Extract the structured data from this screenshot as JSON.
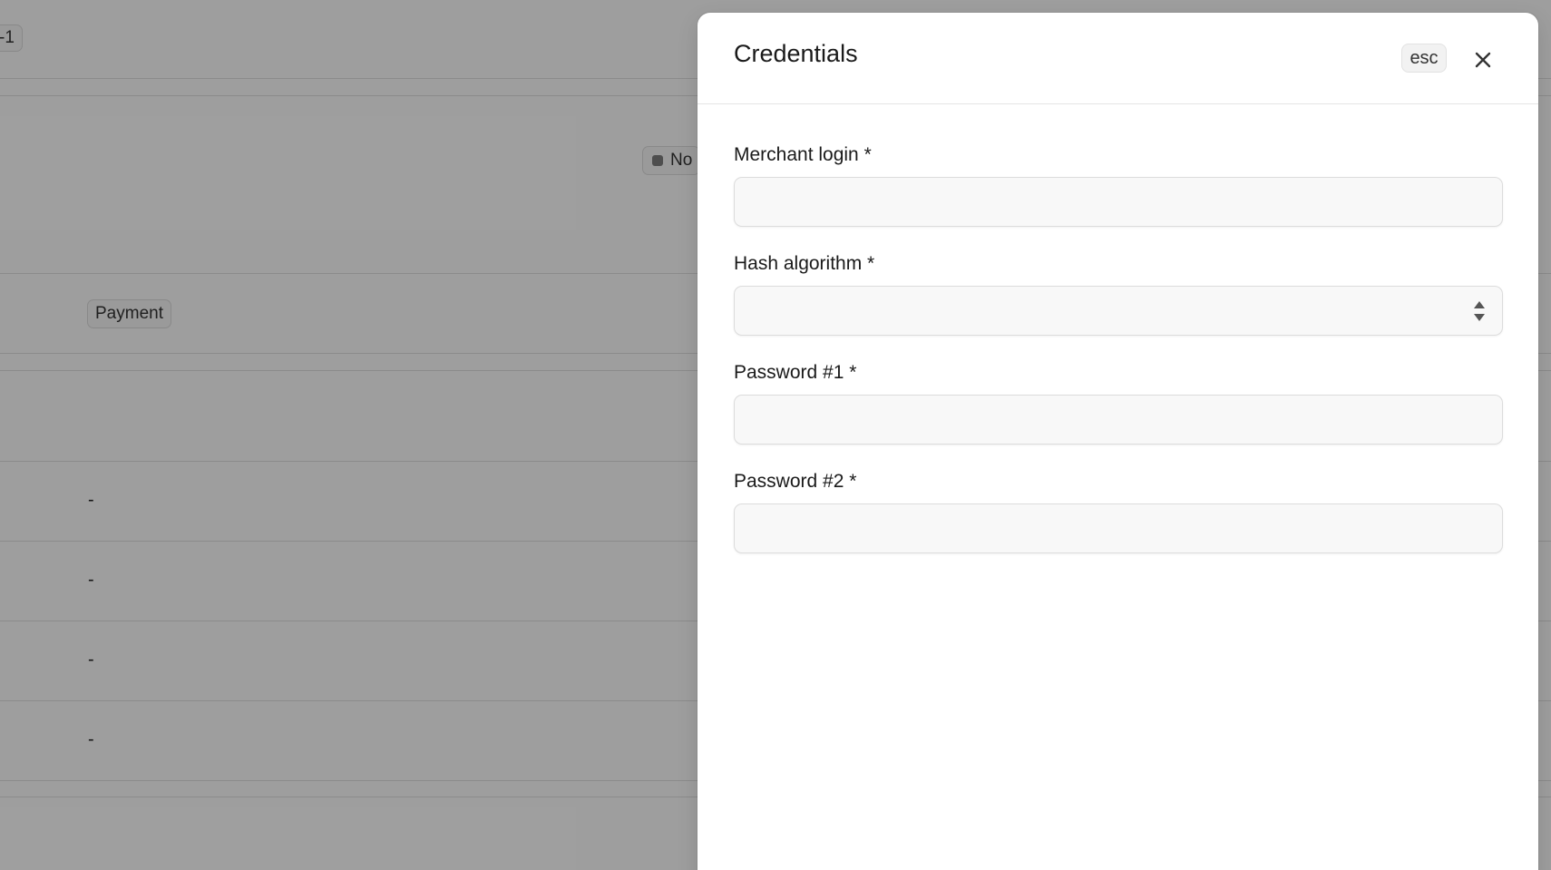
{
  "background": {
    "id_chip": "-1",
    "status_chip": "No",
    "payment_chip": "Payment",
    "row_values": [
      "-",
      "-",
      "-",
      "-"
    ]
  },
  "drawer": {
    "title": "Credentials",
    "esc_label": "esc",
    "close_icon": "close-icon",
    "fields": {
      "merchant_login": {
        "label": "Merchant login *",
        "value": ""
      },
      "hash_algorithm": {
        "label": "Hash algorithm *",
        "value": "",
        "icon": "chevron-up-down-icon"
      },
      "password1": {
        "label": "Password #1 *",
        "value": ""
      },
      "password2": {
        "label": "Password #2 *",
        "value": ""
      }
    }
  },
  "colors": {
    "overlay": "#000000",
    "drawer_bg": "#ffffff",
    "input_bg": "#f8f8f8",
    "input_border": "#dcdcdc"
  }
}
